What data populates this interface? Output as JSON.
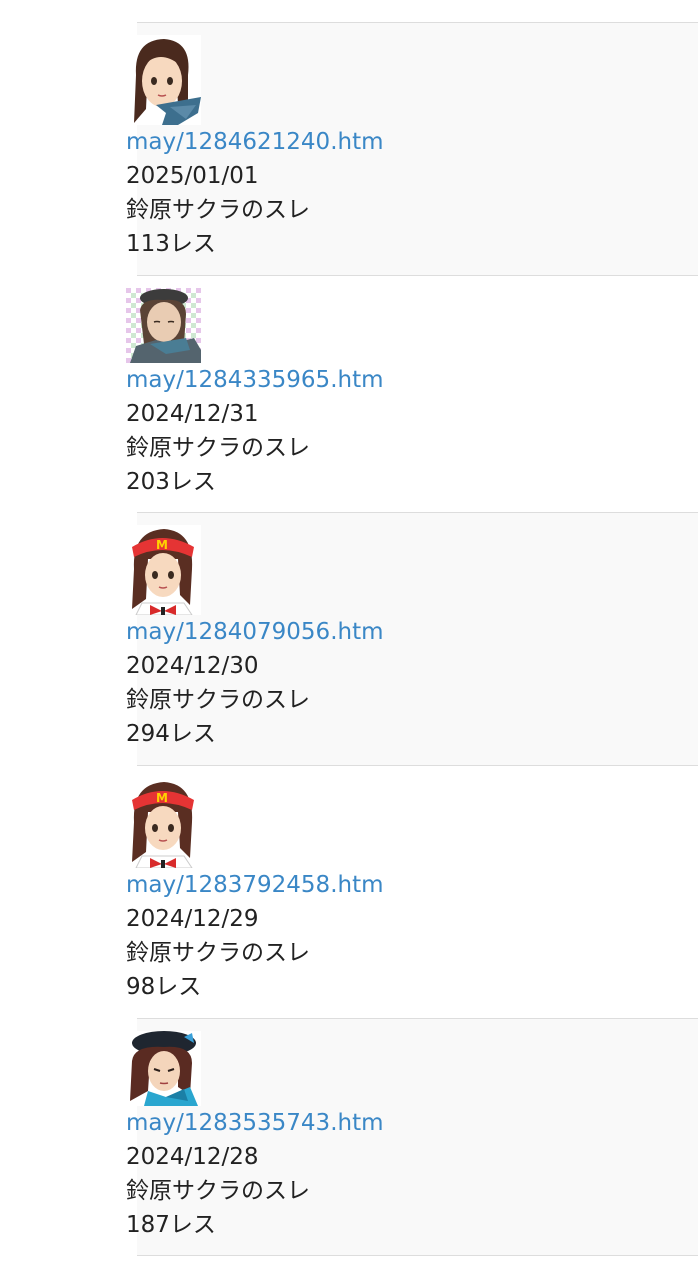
{
  "threads": [
    {
      "link": "may/1284621240.htm",
      "date": "2025/01/01",
      "title": "鈴原サクラのスレ",
      "replies": "113レス",
      "thumb_icon": "anime-girl-scarf-icon"
    },
    {
      "link": "may/1284335965.htm",
      "date": "2024/12/31",
      "title": "鈴原サクラのスレ",
      "replies": "203レス",
      "thumb_icon": "anime-girl-beret-icon"
    },
    {
      "link": "may/1284079056.htm",
      "date": "2024/12/30",
      "title": "鈴原サクラのスレ",
      "replies": "294レス",
      "thumb_icon": "anime-girl-red-visor-icon"
    },
    {
      "link": "may/1283792458.htm",
      "date": "2024/12/29",
      "title": "鈴原サクラのスレ",
      "replies": "98レス",
      "thumb_icon": "anime-girl-red-visor-icon"
    },
    {
      "link": "may/1283535743.htm",
      "date": "2024/12/28",
      "title": "鈴原サクラのスレ",
      "replies": "187レス",
      "thumb_icon": "anime-girl-black-beret-icon"
    }
  ],
  "colors": {
    "link": "#3a87c6",
    "text": "#222222",
    "row_alt_bg": "#f9f9f9",
    "divider": "#dddddd"
  }
}
